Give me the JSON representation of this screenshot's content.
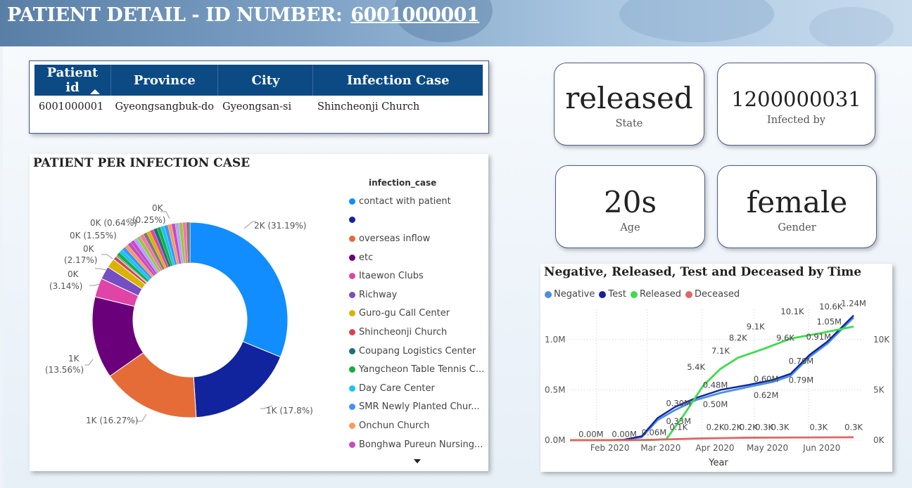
{
  "header": {
    "title": "PATIENT DETAIL - ID NUMBER:",
    "id_number": "6001000001"
  },
  "patient_table": {
    "columns": [
      "Patient id",
      "Province",
      "City",
      "Infection Case"
    ],
    "rows": [
      [
        "6001000001",
        "Gyeongsangbuk-do",
        "Gyeongsan-si",
        "Shincheonji Church"
      ]
    ]
  },
  "kpis": {
    "state": {
      "value": "released",
      "label": "State"
    },
    "infected_by": {
      "value": "1200000031",
      "label": "Infected by"
    },
    "age": {
      "value": "20s",
      "label": "Age"
    },
    "gender": {
      "value": "female",
      "label": "Gender"
    }
  },
  "donut_chart": {
    "title": "PATIENT PER INFECTION CASE",
    "legend_title": "infection_case",
    "legend": [
      {
        "label": "contact with patient",
        "color": "#118dff"
      },
      {
        "label": "",
        "color": "#12239e"
      },
      {
        "label": "overseas inflow",
        "color": "#e66c37"
      },
      {
        "label": "etc",
        "color": "#6b007b"
      },
      {
        "label": "Itaewon Clubs",
        "color": "#e044a7"
      },
      {
        "label": "Richway",
        "color": "#744ec2"
      },
      {
        "label": "Guro-gu Call Center",
        "color": "#d9b300"
      },
      {
        "label": "Shincheonji Church",
        "color": "#d64550"
      },
      {
        "label": "Coupang Logistics Center",
        "color": "#197278"
      },
      {
        "label": "Yangcheon Table Tennis C...",
        "color": "#1aab40"
      },
      {
        "label": "Day Care Center",
        "color": "#15c6f4"
      },
      {
        "label": "SMR Newly Planted Chur...",
        "color": "#4092ff"
      },
      {
        "label": "Onchun Church",
        "color": "#ff9a58"
      },
      {
        "label": "Bonghwa Pureun Nursing...",
        "color": "#c14dc6"
      }
    ],
    "labels": {
      "a": "2K (31.19%)",
      "b": "1K (17.8%)",
      "c": "1K (16.27%)",
      "d1": "1K",
      "d2": "(13.56%)",
      "e1": "0K",
      "e2": "(3.14%)",
      "f1": "0K",
      "f2": "(2.17%)",
      "g": "0K (1.55%)",
      "h": "0K (0.64%)",
      "i1": "0K",
      "i2": "(0.25%)"
    }
  },
  "chart_data": {
    "type": "line",
    "title": "Negative, Released, Test and Deceased by Time",
    "xlabel": "Year",
    "x_ticks": [
      "Feb 2020",
      "Mar 2020",
      "Apr 2020",
      "May 2020",
      "Jun 2020"
    ],
    "y_left_ticks": [
      "0.0M",
      "0.5M",
      "1.0M"
    ],
    "y_right_ticks": [
      "0K",
      "5K",
      "10K"
    ],
    "ylim_left": [
      0,
      1300000
    ],
    "ylim_right": [
      0,
      13000
    ],
    "legend_placement": "top-left",
    "grid": true,
    "series": [
      {
        "name": "Negative",
        "axis": "left",
        "color": "#4a90e2",
        "x": [
          "2020-01-20",
          "2020-02-10",
          "2020-02-20",
          "2020-03-01",
          "2020-03-10",
          "2020-03-20",
          "2020-04-01",
          "2020-04-15",
          "2020-05-01",
          "2020-05-15",
          "2020-05-25",
          "2020-06-05",
          "2020-06-15",
          "2020-06-30"
        ],
        "values": [
          0,
          0,
          5000,
          30000,
          200000,
          300000,
          400000,
          470000,
          530000,
          580000,
          640000,
          830000,
          960000,
          1220000
        ]
      },
      {
        "name": "Test",
        "axis": "left",
        "color": "#12239e",
        "x": [
          "2020-01-20",
          "2020-02-10",
          "2020-02-20",
          "2020-03-01",
          "2020-03-10",
          "2020-03-20",
          "2020-04-01",
          "2020-04-15",
          "2020-05-01",
          "2020-05-15",
          "2020-05-25",
          "2020-06-05",
          "2020-06-15",
          "2020-06-30"
        ],
        "values": [
          0,
          0,
          5000,
          40000,
          220000,
          330000,
          420000,
          500000,
          550000,
          600000,
          660000,
          850000,
          980000,
          1240000
        ]
      },
      {
        "name": "Released",
        "axis": "right",
        "color": "#3ddc4c",
        "x": [
          "2020-01-20",
          "2020-03-05",
          "2020-03-15",
          "2020-03-25",
          "2020-04-05",
          "2020-04-15",
          "2020-04-25",
          "2020-05-10",
          "2020-05-25",
          "2020-06-10",
          "2020-06-30"
        ],
        "values": [
          0,
          0,
          100,
          2500,
          5400,
          7100,
          8200,
          9100,
          10100,
          10600,
          11300
        ]
      },
      {
        "name": "Deceased",
        "axis": "right",
        "color": "#e06666",
        "x": [
          "2020-01-20",
          "2020-02-20",
          "2020-03-10",
          "2020-04-01",
          "2020-05-01",
          "2020-06-01",
          "2020-06-30"
        ],
        "values": [
          0,
          0,
          50,
          160,
          250,
          270,
          290
        ]
      }
    ],
    "data_labels": [
      {
        "text": "0.00M",
        "x": "2020-02-01",
        "axis": "left",
        "y": 30000
      },
      {
        "text": "0.00M",
        "x": "2020-02-20",
        "axis": "left",
        "y": 30000
      },
      {
        "text": "0.06M",
        "x": "2020-03-08",
        "axis": "left",
        "y": 50000
      },
      {
        "text": "0.30M",
        "x": "2020-03-22",
        "axis": "left",
        "y": 340000
      },
      {
        "text": "0.33M",
        "x": "2020-03-22",
        "axis": "left",
        "y": 160000
      },
      {
        "text": "0.48M",
        "x": "2020-04-12",
        "axis": "left",
        "y": 520000
      },
      {
        "text": "0.50M",
        "x": "2020-04-12",
        "axis": "left",
        "y": 330000
      },
      {
        "text": "0.60M",
        "x": "2020-05-11",
        "axis": "left",
        "y": 580000
      },
      {
        "text": "0.62M",
        "x": "2020-05-11",
        "axis": "left",
        "y": 420000
      },
      {
        "text": "0.76M",
        "x": "2020-05-31",
        "axis": "left",
        "y": 760000
      },
      {
        "text": "0.79M",
        "x": "2020-05-31",
        "axis": "left",
        "y": 570000
      },
      {
        "text": "0.91M",
        "x": "2020-06-10",
        "axis": "left",
        "y": 1000000
      },
      {
        "text": "1.05M",
        "x": "2020-06-16",
        "axis": "left",
        "y": 1150000
      },
      {
        "text": "1.24M",
        "x": "2020-06-30",
        "axis": "left",
        "y": 1330000
      },
      {
        "text": "0.1K",
        "x": "2020-03-22",
        "axis": "right",
        "y": 1000
      },
      {
        "text": "5.4K",
        "x": "2020-04-01",
        "axis": "right",
        "y": 7000
      },
      {
        "text": "7.1K",
        "x": "2020-04-15",
        "axis": "right",
        "y": 8600
      },
      {
        "text": "8.2K",
        "x": "2020-04-25",
        "axis": "right",
        "y": 9900
      },
      {
        "text": "9.1K",
        "x": "2020-05-05",
        "axis": "right",
        "y": 11000
      },
      {
        "text": "10.1K",
        "x": "2020-05-26",
        "axis": "right",
        "y": 12500
      },
      {
        "text": "10.6K",
        "x": "2020-06-17",
        "axis": "right",
        "y": 13000
      },
      {
        "text": "9.6K",
        "x": "2020-05-22",
        "axis": "right",
        "y": 9900
      },
      {
        "text": "0.2K",
        "x": "2020-04-12",
        "axis": "right",
        "y": 1000
      },
      {
        "text": "0.2K",
        "x": "2020-04-22",
        "axis": "right",
        "y": 1000
      },
      {
        "text": "0.2K",
        "x": "2020-05-01",
        "axis": "right",
        "y": 1000
      },
      {
        "text": "0.3K",
        "x": "2020-05-10",
        "axis": "right",
        "y": 1000
      },
      {
        "text": "0.3K",
        "x": "2020-05-19",
        "axis": "right",
        "y": 1000
      },
      {
        "text": "0.3K",
        "x": "2020-06-10",
        "axis": "right",
        "y": 1000
      },
      {
        "text": "0.3K",
        "x": "2020-06-30",
        "axis": "right",
        "y": 1000
      }
    ]
  }
}
